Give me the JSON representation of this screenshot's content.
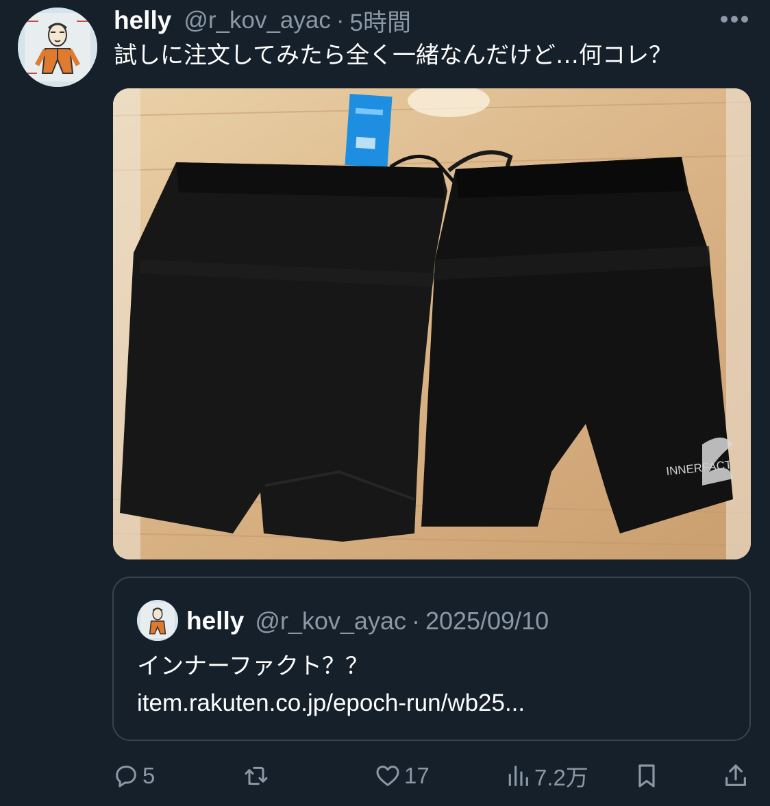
{
  "post": {
    "display_name": "helly",
    "handle": "@r_kov_ayac",
    "separator": "·",
    "time": "5時間",
    "text": "試しに注文してみたら全く一緒なんだけど…何コレ？",
    "more_icon": "more-horizontal-icon",
    "media_logo_text": "INNERFACT"
  },
  "quote": {
    "display_name": "helly",
    "handle": "@r_kov_ayac",
    "separator": "·",
    "date": "2025/09/10",
    "text_line1": "インナーファクト？？",
    "text_line2": "item.rakuten.co.jp/epoch-run/wb25..."
  },
  "actions": {
    "reply": {
      "icon": "reply-icon",
      "count": "5"
    },
    "retweet": {
      "icon": "retweet-icon",
      "count": ""
    },
    "like": {
      "icon": "heart-icon",
      "count": "17"
    },
    "views": {
      "icon": "views-bar-chart-icon",
      "count": "7.2万"
    },
    "bookmark": {
      "icon": "bookmark-icon"
    },
    "share": {
      "icon": "share-icon"
    }
  },
  "colors": {
    "background": "#15202b",
    "secondary_text": "#8b98a5",
    "border": "#38444d",
    "text": "#ffffff"
  }
}
